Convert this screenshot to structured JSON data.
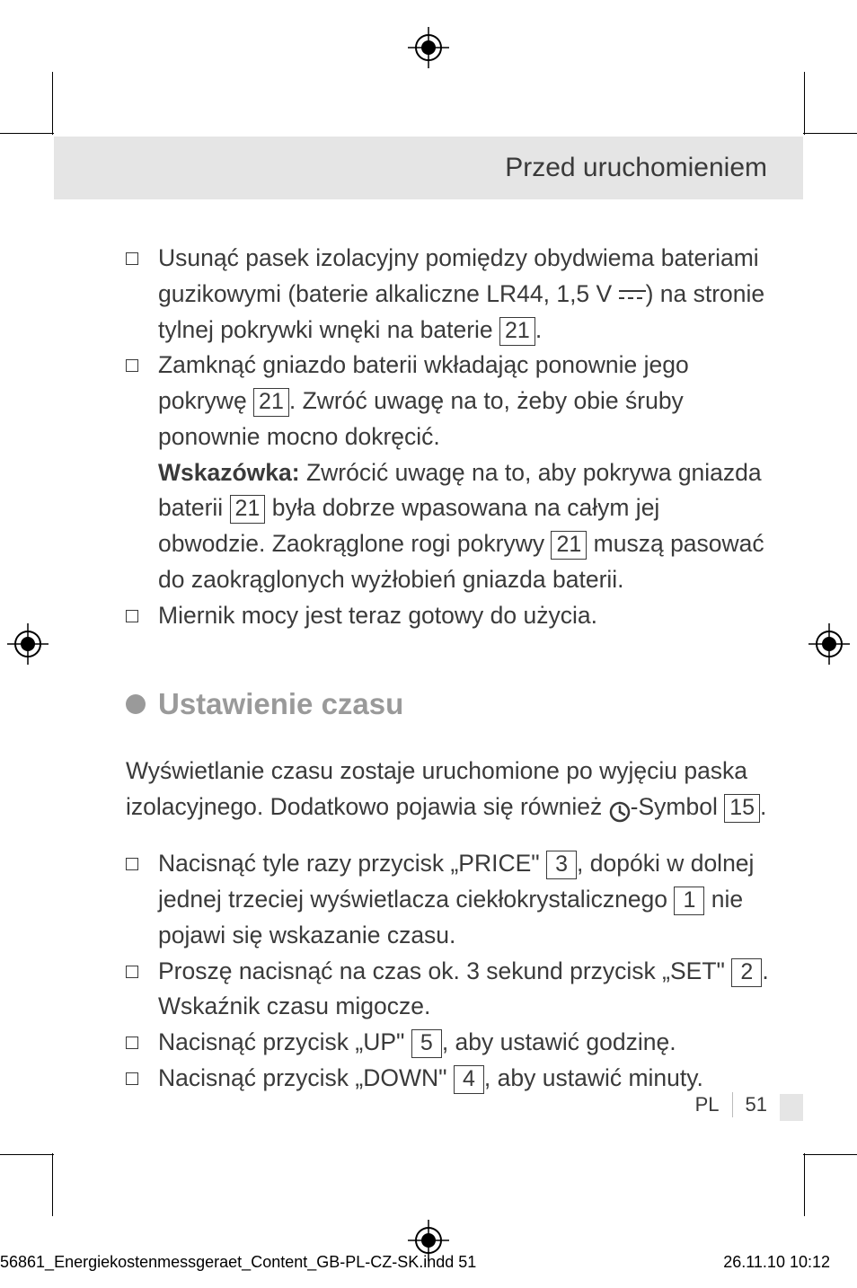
{
  "header": {
    "title": "Przed uruchomieniem"
  },
  "content": {
    "list1": {
      "item1_a": "Usunąć pasek izolacyjny pomiędzy obydwiema bateriami guzikowymi (baterie alkaliczne LR44, 1,5 V ",
      "item1_b": ") na stronie tylnej pokrywki wnęki na baterie ",
      "item1_c": ".",
      "ref21a": "21",
      "item2_a": "Zamknąć gniazdo baterii wkładając ponownie jego pokrywę ",
      "ref21b": "21",
      "item2_b": ". Zwróć uwagę na to, żeby obie śruby ponownie mocno dokręcić.",
      "hint_label": "Wskazówka:",
      "hint_a": " Zwrócić uwagę na to, aby pokrywa gniazda baterii ",
      "ref21c": "21",
      "hint_b": " była dobrze wpasowana na całym jej obwodzie. Zaokrąglone rogi pokrywy ",
      "ref21d": "21",
      "hint_c": " muszą pasować do zaokrąglonych wyżłobień gniazda baterii.",
      "item3": "Miernik mocy jest teraz gotowy do użycia."
    },
    "section_title": "Ustawienie czasu",
    "para_a": "Wyświetlanie czasu zostaje uruchomione po wyjęciu paska izolacyjnego. Dodatkowo pojawia się również ",
    "para_b": "-Symbol ",
    "ref15": "15",
    "para_c": ".",
    "list2": {
      "i1_a": "Nacisnąć tyle razy przycisk „PRICE\" ",
      "ref3": "3",
      "i1_b": ", dopóki w dolnej jednej trzeciej wyświetlacza ciekłokrystalicznego ",
      "ref1": "1",
      "i1_c": " nie pojawi się wskazanie czasu.",
      "i2_a": "Proszę nacisnąć na czas ok. 3 sekund przycisk „SET\" ",
      "ref2": "2",
      "i2_b": ". Wskaźnik czasu migocze.",
      "i3_a": "Nacisnąć przycisk „UP\" ",
      "ref5": "5",
      "i3_b": ", aby ustawić godzinę.",
      "i4_a": "Nacisnąć przycisk „DOWN\" ",
      "ref4": "4",
      "i4_b": ", aby ustawić minuty."
    }
  },
  "footer": {
    "lang": "PL",
    "page": "51",
    "filename": "56861_Energiekostenmessgeraet_Content_GB-PL-CZ-SK.indd   51",
    "timestamp": "26.11.10   10:12"
  }
}
